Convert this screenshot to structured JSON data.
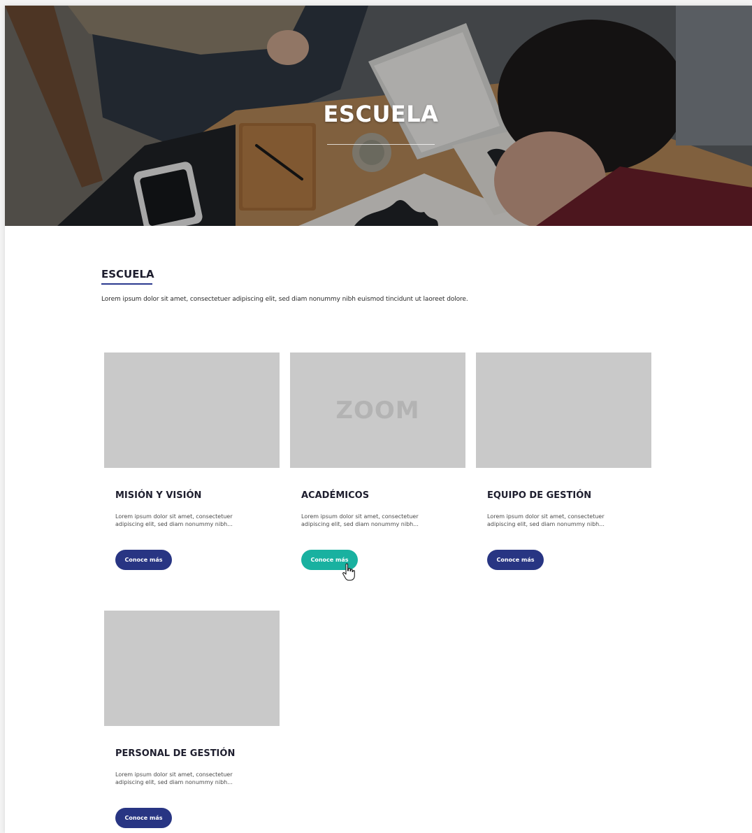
{
  "hero": {
    "title": "ESCUELA"
  },
  "section": {
    "title": "ESCUELA",
    "description": "Lorem ipsum dolor sit amet, consectetuer adipiscing elit, sed diam nonummy nibh euismod tincidunt ut laoreet dolore."
  },
  "cards": [
    {
      "title": "MISIÓN Y VISIÓN",
      "description": "Lorem ipsum dolor sit amet, consectetuer adipiscing elit, sed diam nonummy nibh...",
      "button_label": "Conoce más",
      "image_label": ""
    },
    {
      "title": "ACADÉMICOS",
      "description": "Lorem ipsum dolor sit amet, consectetuer adipiscing elit, sed diam nonummy nibh...",
      "button_label": "Conoce más",
      "image_label": "ZOOM",
      "button_state": "hover"
    },
    {
      "title": "EQUIPO DE GESTIÓN",
      "description": "Lorem ipsum dolor sit amet, consectetuer adipiscing elit, sed diam nonummy nibh...",
      "button_label": "Conoce más",
      "image_label": ""
    },
    {
      "title": "PERSONAL DE GESTIÓN",
      "description": "Lorem ipsum dolor sit amet, consectetuer adipiscing elit, sed diam nonummy nibh...",
      "button_label": "Conoce más",
      "image_label": ""
    }
  ],
  "colors": {
    "primary_button": "#283583",
    "hover_button": "#19b1a0",
    "placeholder_image": "#c9c9c9",
    "accent_underline": "#2b3a8f"
  },
  "icons": {
    "cursor": "hand-pointer-icon"
  }
}
